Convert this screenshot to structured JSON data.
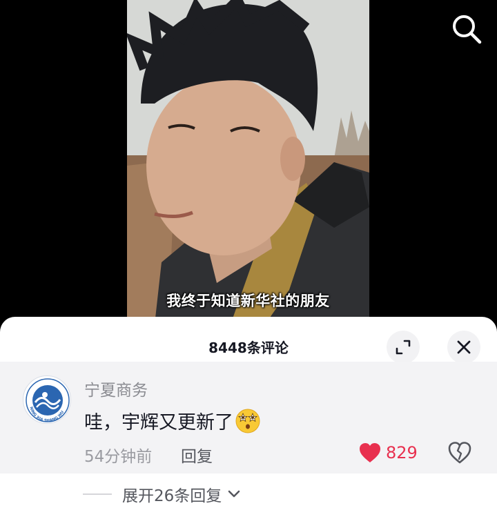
{
  "video": {
    "subtitle": "我终于知道新华社的朋友"
  },
  "top_bar": {
    "search_icon": "search-icon"
  },
  "comments_sheet": {
    "title": "8448条评论",
    "expand_icon": "expand-icon",
    "close_icon": "close-icon",
    "comment": {
      "author": "宁夏商务",
      "avatar_text": "NING XIA SHANG WU",
      "text": "哇，宇辉又更新了",
      "emoji": "starry-eyes-emoji",
      "time": "54分钟前",
      "reply_label": "回复",
      "like_count": "829",
      "like_color": "#e8304f",
      "liked": true
    },
    "expand_replies_label": "展开26条回复"
  }
}
